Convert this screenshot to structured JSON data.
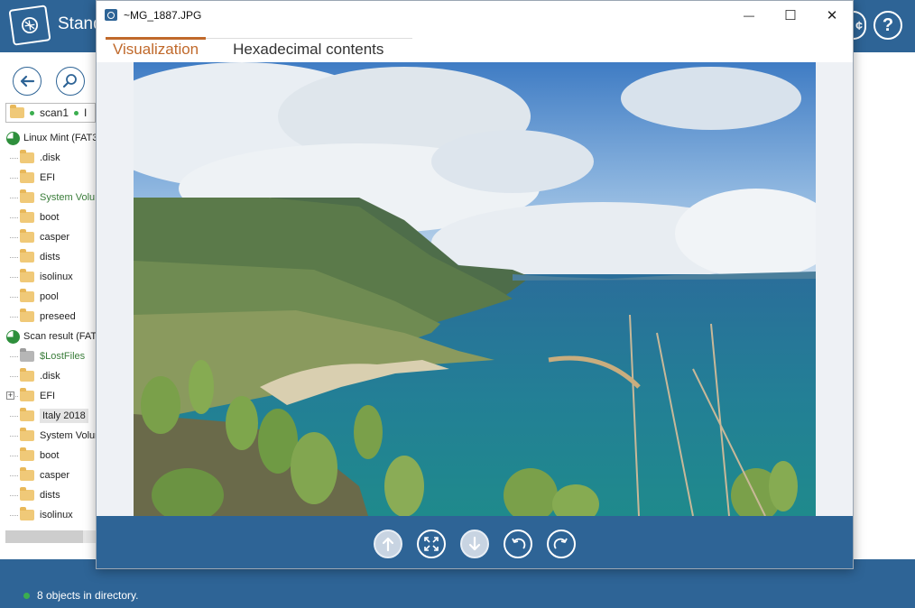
{
  "app": {
    "title": "Stand",
    "tree": [
      {
        "label": "Linux Mint (FAT3",
        "type": "root"
      },
      {
        "label": ".disk",
        "type": "folder"
      },
      {
        "label": "EFI",
        "type": "folder"
      },
      {
        "label": "System Volu",
        "type": "folder",
        "style": "green"
      },
      {
        "label": "boot",
        "type": "folder"
      },
      {
        "label": "casper",
        "type": "folder"
      },
      {
        "label": "dists",
        "type": "folder"
      },
      {
        "label": "isolinux",
        "type": "folder"
      },
      {
        "label": "pool",
        "type": "folder"
      },
      {
        "label": "preseed",
        "type": "folder"
      },
      {
        "label": "Scan result (FAT",
        "type": "root"
      },
      {
        "label": "$LostFiles",
        "type": "folder-gray",
        "style": "green"
      },
      {
        "label": ".disk",
        "type": "folder"
      },
      {
        "label": "EFI",
        "type": "folder",
        "expand": "+"
      },
      {
        "label": "Italy 2018",
        "type": "folder",
        "selected": true
      },
      {
        "label": "System Volur",
        "type": "folder"
      },
      {
        "label": "boot",
        "type": "folder"
      },
      {
        "label": "casper",
        "type": "folder"
      },
      {
        "label": "dists",
        "type": "folder"
      },
      {
        "label": "isolinux",
        "type": "folder"
      }
    ],
    "path": {
      "part1": "scan1",
      "part2": "I"
    },
    "status": "8 objects in directory.",
    "header_buttons": {
      "help": "?",
      "other": "¢"
    }
  },
  "dialog": {
    "title": "~MG_1887.JPG",
    "controls": {
      "minimize": "—",
      "maximize": "☐",
      "close": "✕"
    },
    "tabs": [
      {
        "label": "Visualization",
        "active": true
      },
      {
        "label": "Hexadecimal contents",
        "active": false
      }
    ],
    "image_icon": "landscape-photo-icon",
    "nav_buttons": [
      {
        "name": "previous-button",
        "icon": "arrow-up-icon"
      },
      {
        "name": "fit-to-screen-button",
        "icon": "expand-icon"
      },
      {
        "name": "next-button",
        "icon": "arrow-down-icon"
      },
      {
        "name": "rotate-left-button",
        "icon": "rotate-ccw-icon"
      },
      {
        "name": "rotate-right-button",
        "icon": "rotate-cw-icon"
      }
    ]
  },
  "colors": {
    "brand": "#2e6496",
    "accent": "#c0692b",
    "ok": "#3bae4f"
  }
}
